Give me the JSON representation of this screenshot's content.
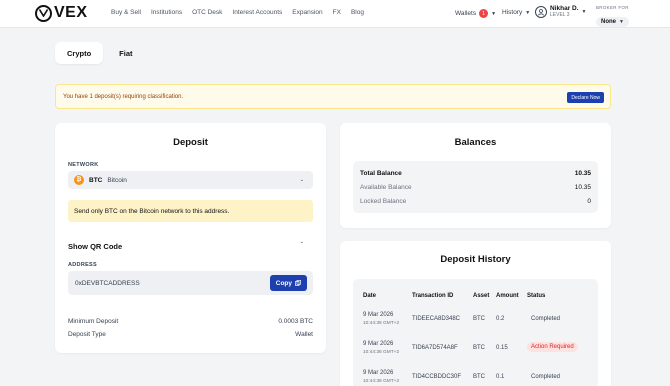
{
  "header": {
    "logo_text": "VEX",
    "nav": [
      "Buy & Sell",
      "Institutions",
      "OTC Desk",
      "Interest Accounts",
      "Expansion",
      "FX",
      "Blog"
    ],
    "wallets_label": "Wallets",
    "wallets_badge": "1",
    "history_label": "History",
    "user_name": "Nikhar D.",
    "user_level": "LEVEL 3",
    "broker_label": "BROKER FOR",
    "broker_value": "None"
  },
  "tabs": [
    "Crypto",
    "Fiat"
  ],
  "alert": {
    "text": "You have 1 deposit(s) requiring classification.",
    "button": "Declare Now"
  },
  "deposit": {
    "title": "Deposit",
    "network_label": "NETWORK",
    "network_code": "BTC",
    "network_name": "Bitcoin",
    "coin_symbol": "₿",
    "warning": "Send only BTC on the Bitcoin network to this address.",
    "qr_label": "Show QR Code",
    "address_label": "ADDRESS",
    "address_value": "0xDEVBTCADDRESS",
    "copy_label": "Copy",
    "min_deposit_label": "Minimum Deposit",
    "min_deposit_value": "0.0003 BTC",
    "deposit_type_label": "Deposit Type",
    "deposit_type_value": "Wallet"
  },
  "balances": {
    "title": "Balances",
    "rows": [
      {
        "label": "Total Balance",
        "value": "10.35"
      },
      {
        "label": "Available Balance",
        "value": "10.35"
      },
      {
        "label": "Locked Balance",
        "value": "0"
      }
    ]
  },
  "history": {
    "title": "Deposit History",
    "columns": [
      "Date",
      "Transaction ID",
      "Asset",
      "Amount",
      "Status"
    ],
    "rows": [
      {
        "date": "9 Mar 2026",
        "time": "10:44:38 GMT+2",
        "txid": "TIDEECA8D348C",
        "asset": "BTC",
        "amount": "0.2",
        "status": "Completed"
      },
      {
        "date": "9 Mar 2026",
        "time": "10:44:38 GMT+2",
        "txid": "TID6A7D574A8F",
        "asset": "BTC",
        "amount": "0.15",
        "status": "Action Required"
      },
      {
        "date": "9 Mar 2026",
        "time": "10:44:38 GMT+2",
        "txid": "TID4CCBDDC30F",
        "asset": "BTC",
        "amount": "0.1",
        "status": "Completed"
      }
    ]
  },
  "colors": {
    "accent": "#1e40af",
    "warning_bg": "#fef3c7",
    "danger": "#dc2626",
    "bitcoin": "#f7931a"
  }
}
